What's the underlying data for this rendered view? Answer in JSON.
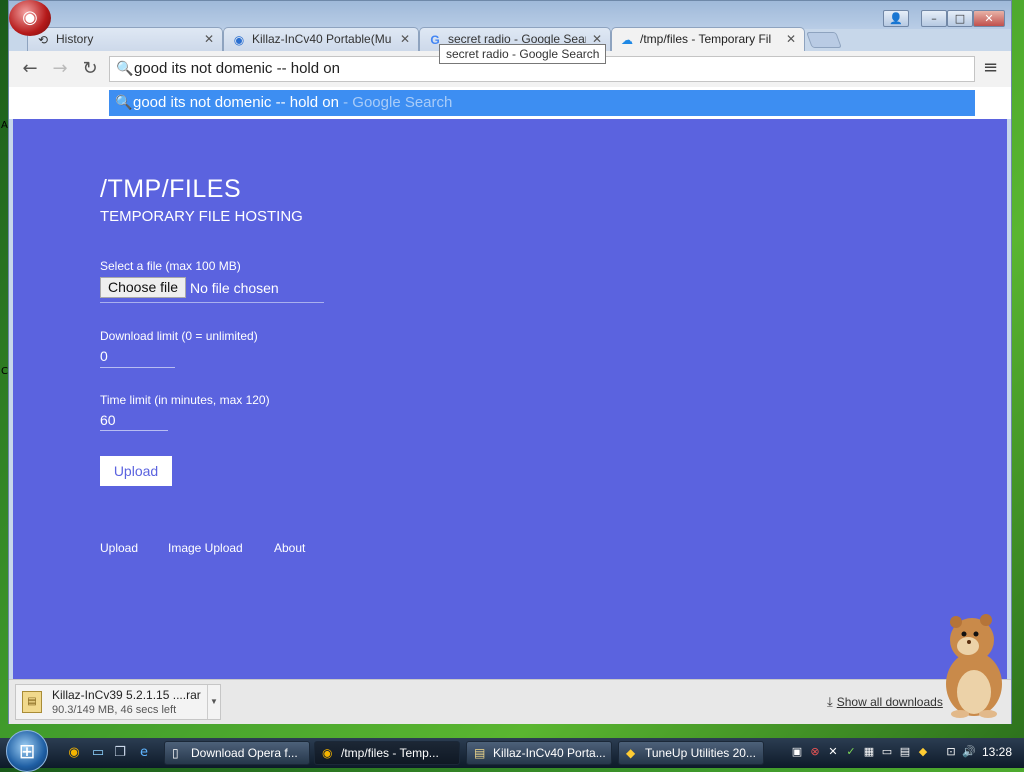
{
  "browser": {
    "tabs": [
      {
        "title": "History",
        "icon": "history-icon",
        "active": false
      },
      {
        "title": "Killaz-InCv40 Portable(Mu",
        "icon": "site-icon",
        "active": false
      },
      {
        "title": "secret radio - Google Sear",
        "icon": "google-icon",
        "active": false
      },
      {
        "title": "/tmp/files - Temporary Fil",
        "icon": "cloud-icon",
        "active": true
      }
    ],
    "tooltip": "secret radio - Google Search",
    "omnibox_text": "good its not domenic -- hold on",
    "suggestion": {
      "query": "good its not domenic -- hold on",
      "suffix": " - Google Search"
    }
  },
  "page": {
    "title": "/TMP/FILES",
    "subtitle": "TEMPORARY FILE HOSTING",
    "file_label": "Select a file (max 100 MB)",
    "choose_file": "Choose file",
    "no_file": "No file chosen",
    "download_limit_label": "Download limit (0 = unlimited)",
    "download_limit_value": "0",
    "time_limit_label": "Time limit (in minutes, max 120)",
    "time_limit_value": "60",
    "upload_button": "Upload",
    "footer_links": [
      "Upload",
      "Image Upload",
      "About"
    ],
    "background_color": "#5b63df"
  },
  "download_shelf": {
    "file_name": "Killaz-InCv39 5.2.1.15 ....rar",
    "status": "90.3/149 MB, 46 secs left",
    "show_all": "Show all downloads"
  },
  "taskbar": {
    "tasks": [
      {
        "label": "Download Opera f...",
        "active": false
      },
      {
        "label": "/tmp/files - Temp...",
        "active": true
      },
      {
        "label": "Killaz-InCv40 Porta...",
        "active": false
      },
      {
        "label": "TuneUp Utilities 20...",
        "active": false
      }
    ],
    "clock": "13:28"
  }
}
